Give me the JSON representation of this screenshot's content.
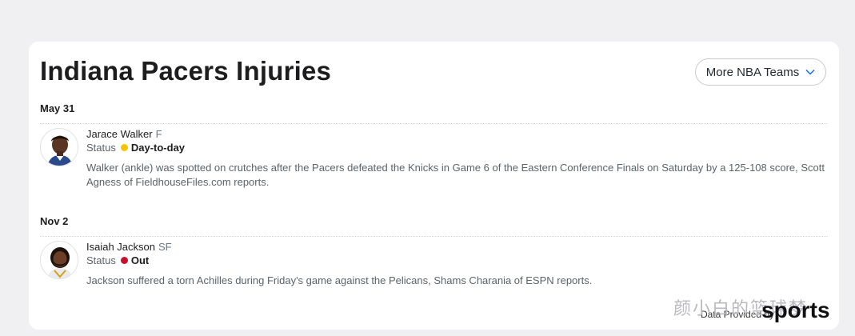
{
  "header": {
    "title": "Indiana Pacers Injuries",
    "teams_button": "More NBA Teams"
  },
  "status_label": "Status",
  "injuries": [
    {
      "date": "May 31",
      "player": "Jarace Walker",
      "position": "F",
      "status": "Day-to-day",
      "status_color": "#f5c400",
      "note": "Walker (ankle) was spotted on crutches after the Pacers defeated the Knicks in Game 6 of the Eastern Conference Finals on Saturday by a 125-108 score, Scott Agness of FieldhouseFiles.com reports."
    },
    {
      "date": "Nov 2",
      "player": "Isaiah Jackson",
      "position": "SF",
      "status": "Out",
      "status_color": "#c8102e",
      "note": "Jackson suffered a torn Achilles during Friday's game against the Pelicans, Shams Charania of ESPN reports."
    }
  ],
  "footer": {
    "watermark": "颜小白的篮球梦",
    "credit": "Data Provided by",
    "brand": "sports"
  },
  "colors": {
    "background": "#f0f0f3",
    "card": "#ffffff",
    "chevron": "#0f69ff"
  }
}
